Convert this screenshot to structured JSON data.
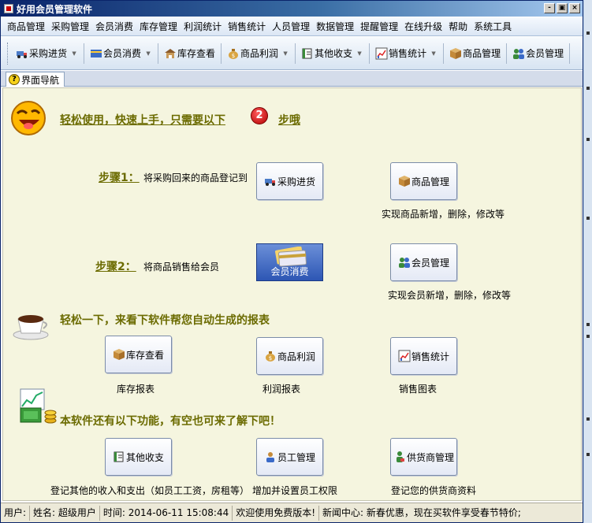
{
  "window": {
    "title": "好用会员管理软件",
    "controls": [
      "-",
      "▣",
      "×"
    ]
  },
  "menu": [
    "商品管理",
    "采购管理",
    "会员消费",
    "库存管理",
    "利润统计",
    "销售统计",
    "人员管理",
    "数据管理",
    "提醒管理",
    "在线升级",
    "帮助",
    "系统工具"
  ],
  "toolbar": [
    {
      "label": "采购进货",
      "icon": "truck-icon",
      "arrow": true
    },
    {
      "label": "会员消费",
      "icon": "card-icon",
      "arrow": true
    },
    {
      "label": "库存查看",
      "icon": "warehouse-icon",
      "arrow": false
    },
    {
      "label": "商品利润",
      "icon": "money-bag-icon",
      "arrow": true
    },
    {
      "label": "其他收支",
      "icon": "ledger-icon",
      "arrow": true
    },
    {
      "label": "销售统计",
      "icon": "chart-icon",
      "arrow": true
    },
    {
      "label": "商品管理",
      "icon": "box-icon",
      "arrow": false
    },
    {
      "label": "会员管理",
      "icon": "users-icon",
      "arrow": false
    }
  ],
  "tab": {
    "label": "界面导航"
  },
  "guide": {
    "intro_text": "轻松使用，快速上手，只需要以下",
    "intro_number": "2",
    "intro_suffix": "步哦",
    "step1_label": "步骤1：",
    "step1_text": "将采购回来的商品登记到",
    "step2_label": "步骤2：",
    "step2_text": "将商品销售给会员",
    "report_heading": "轻松一下，来看下软件帮您自动生成的报表",
    "more_heading": "本软件还有以下功能，有空也可来了解下吧！"
  },
  "buttons": {
    "purchase": "采购进货",
    "goods": "商品管理",
    "goods_desc": "实现商品新增，删除，修改等",
    "member_consume": "会员消费",
    "member_mgmt": "会员管理",
    "member_desc": "实现会员新增，删除，修改等",
    "stock": "库存查看",
    "stock_desc": "库存报表",
    "profit": "商品利润",
    "profit_desc": "利润报表",
    "sales": "销售统计",
    "sales_desc": "销售图表",
    "other": "其他收支",
    "other_desc": "登记其他的收入和支出（如员工工资，房租等）",
    "staff": "员工管理",
    "staff_desc": "增加并设置员工权限",
    "supplier": "供货商管理",
    "supplier_desc": "登记您的供货商资料"
  },
  "status": {
    "user": "用户:",
    "name": "姓名: 超级用户",
    "time": "时间: 2014-06-11 15:08:44",
    "welcome": "欢迎使用免费版本!",
    "news": "新闻中心: 新春优惠，现在买软件享受春节特价;"
  },
  "colors": {
    "heading": "#6b6b00",
    "content_bg": "#f5f5df",
    "accent_red": "#b10000"
  }
}
